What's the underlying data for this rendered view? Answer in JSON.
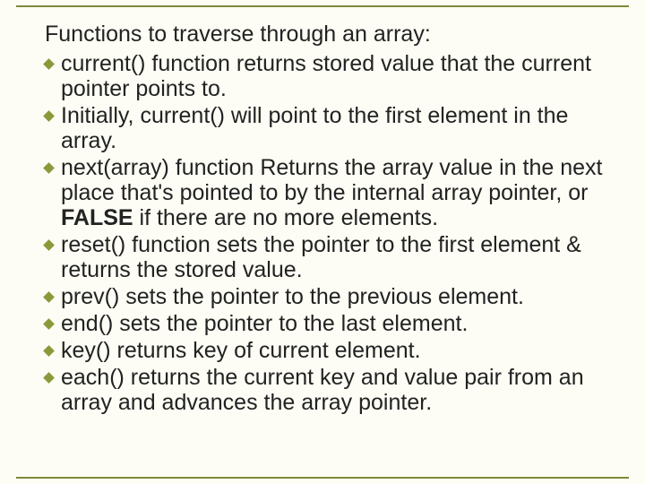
{
  "heading": "Functions to traverse through an array:",
  "bullets": [
    "current() function returns stored value that the current pointer points to.",
    "Initially, current() will point to the first element in the array.",
    {
      "pre": "next(array)  function Returns the array value in the next place that's pointed to by the internal array pointer, or ",
      "bold": "FALSE",
      "post": " if there are no more elements."
    },
    "reset() function sets the pointer to the first element & returns the stored value.",
    "prev() sets the pointer to the previous element.",
    "end() sets the pointer to the last element.",
    "key() returns key of current element.",
    "each() returns the current key and value pair from an array and advances the array pointer."
  ]
}
